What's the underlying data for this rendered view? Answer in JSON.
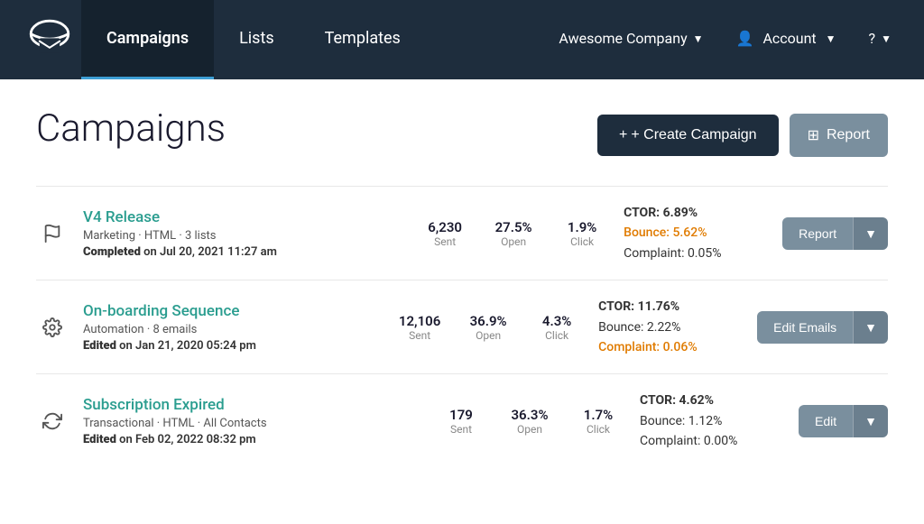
{
  "nav": {
    "logo_alt": "Email Logo",
    "items": [
      {
        "label": "Campaigns",
        "active": true
      },
      {
        "label": "Lists",
        "active": false
      },
      {
        "label": "Templates",
        "active": false
      }
    ],
    "company": "Awesome Company",
    "account": "Account",
    "help": "?"
  },
  "page": {
    "title": "Campaigns",
    "create_button": "+ Create Campaign",
    "report_button": "Report",
    "report_icon": "⊞"
  },
  "campaigns": [
    {
      "id": "v4-release",
      "icon": "flag",
      "name": "V4 Release",
      "meta": "Marketing · HTML · 3 lists",
      "status_label": "Completed",
      "status_date": "on Jul 20, 2021 11:27 am",
      "sent": "6,230",
      "open": "27.5%",
      "click": "1.9%",
      "ctor": "CTOR: 6.89%",
      "bounce": "Bounce: 5.62%",
      "bounce_highlight": true,
      "complaint": "Complaint: 0.05%",
      "complaint_highlight": false,
      "action_label": "Report",
      "action_type": "report"
    },
    {
      "id": "onboarding-sequence",
      "icon": "gear",
      "name": "On-boarding Sequence",
      "meta": "Automation · 8 emails",
      "status_label": "Edited",
      "status_date": "on Jan 21, 2020 05:24 pm",
      "sent": "12,106",
      "open": "36.9%",
      "click": "4.3%",
      "ctor": "CTOR: 11.76%",
      "bounce": "Bounce: 2.22%",
      "bounce_highlight": false,
      "complaint": "Complaint: 0.06%",
      "complaint_highlight": true,
      "action_label": "Edit Emails",
      "action_type": "edit-emails"
    },
    {
      "id": "subscription-expired",
      "icon": "refresh",
      "name": "Subscription Expired",
      "meta": "Transactional · HTML · All Contacts",
      "status_label": "Edited",
      "status_date": "on Feb 02, 2022 08:32 pm",
      "sent": "179",
      "open": "36.3%",
      "click": "1.7%",
      "ctor": "CTOR: 4.62%",
      "bounce": "Bounce: 1.12%",
      "bounce_highlight": false,
      "complaint": "Complaint: 0.00%",
      "complaint_highlight": false,
      "action_label": "Edit",
      "action_type": "edit"
    }
  ]
}
